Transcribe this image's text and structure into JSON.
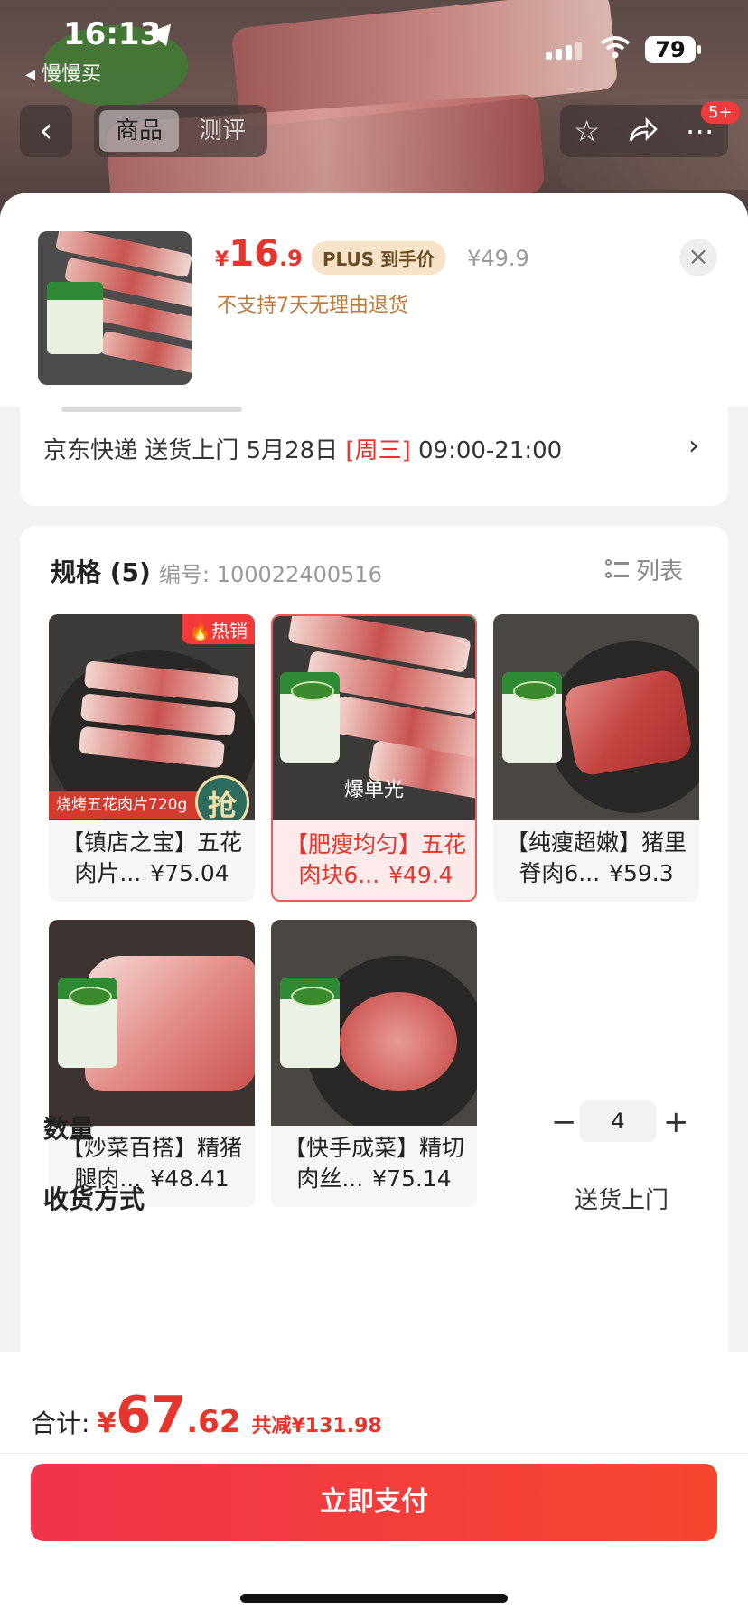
{
  "status_bar": {
    "time": "16:13",
    "back_app": "慢慢买",
    "battery": "79"
  },
  "nav": {
    "tabs": [
      {
        "label": "商品"
      },
      {
        "label": "测评"
      }
    ],
    "badge": "5+"
  },
  "product": {
    "price_yen": "¥",
    "price_int": "16",
    "price_dec": ".9",
    "plus_tag": "PLUS 到手价",
    "orig_price": "¥49.9",
    "no_return": "不支持7天无理由退货"
  },
  "delivery": {
    "text_pre": "京东快递 送货上门 5月28日 ",
    "day": "[周三]",
    "text_post": " 09:00-21:00"
  },
  "spec": {
    "title": "规格 (5)",
    "code": "编号: 100022400516",
    "list_label": "列表",
    "items": [
      {
        "name": "【镇店之宝】五花肉片...",
        "price": "¥75.04",
        "hot": "热销",
        "strip": "烧烤五花肉片720g",
        "grab": "抢"
      },
      {
        "name": "【肥瘦均匀】五花肉块6...",
        "price": "¥49.4",
        "overlay": "爆单光"
      },
      {
        "name": "【纯瘦超嫩】猪里脊肉6...",
        "price": "¥59.3"
      },
      {
        "name": "【炒菜百搭】精猪腿肉...",
        "price": "¥48.41"
      },
      {
        "name": "【快手成菜】精切肉丝...",
        "price": "¥75.14"
      }
    ]
  },
  "quantity": {
    "label": "数量",
    "minus": "−",
    "value": "4",
    "plus": "+"
  },
  "receive": {
    "label": "收货方式",
    "value": "送货上门"
  },
  "bottom": {
    "total_label": "合计:",
    "total_yen": "¥",
    "total_int": "67",
    "total_dec": ".62",
    "saving": "共减¥131.98",
    "pay_label": "立即支付"
  },
  "colors": {
    "accent": "#e5352c",
    "plus_tag_bg": "#f6e3c8",
    "selected_border": "#ef5a5a"
  },
  "icons": [
    "location-arrow-icon",
    "signal-icon",
    "wifi-icon",
    "back-icon",
    "star-icon",
    "share-icon",
    "more-icon",
    "close-icon",
    "chevron-right-icon",
    "list-icon",
    "fire-icon"
  ]
}
